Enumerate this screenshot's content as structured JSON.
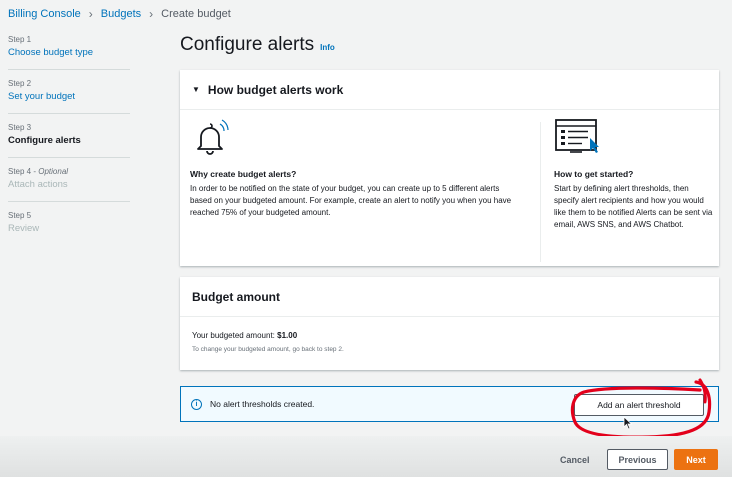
{
  "breadcrumb": {
    "items": [
      "Billing Console",
      "Budgets",
      "Create budget"
    ]
  },
  "steps": [
    {
      "num": "Step 1",
      "title": "Choose budget type"
    },
    {
      "num": "Step 2",
      "title": "Set your budget"
    },
    {
      "num": "Step 3",
      "title": "Configure alerts"
    },
    {
      "num": "Step 4",
      "optional": "Optional",
      "title": "Attach actions"
    },
    {
      "num": "Step 5",
      "title": "Review"
    }
  ],
  "page": {
    "title": "Configure alerts",
    "info": "Info"
  },
  "how": {
    "header": "How budget alerts work",
    "left_heading": "Why create budget alerts?",
    "left_text": "In order to be notified on the state of your budget, you can create up to 5 different alerts based on your budgeted amount. For example, create an alert to notify you when you have reached 75% of your budgeted amount.",
    "right_heading": "How to get started?",
    "right_text": "Start by defining alert thresholds, then specify alert recipients and how you would like them to be notified Alerts can be sent via email, AWS SNS, and AWS Chatbot."
  },
  "amount": {
    "header": "Budget amount",
    "label": "Your budgeted amount:",
    "value": "$1.00",
    "hint": "To change your budgeted amount, go back to step 2."
  },
  "alert": {
    "text": "No alert thresholds created.",
    "button": "Add an alert threshold"
  },
  "footer": {
    "cancel": "Cancel",
    "previous": "Previous",
    "next": "Next"
  },
  "colors": {
    "link": "#0073bb",
    "primary": "#ec7211",
    "annotation": "#e3001b"
  }
}
